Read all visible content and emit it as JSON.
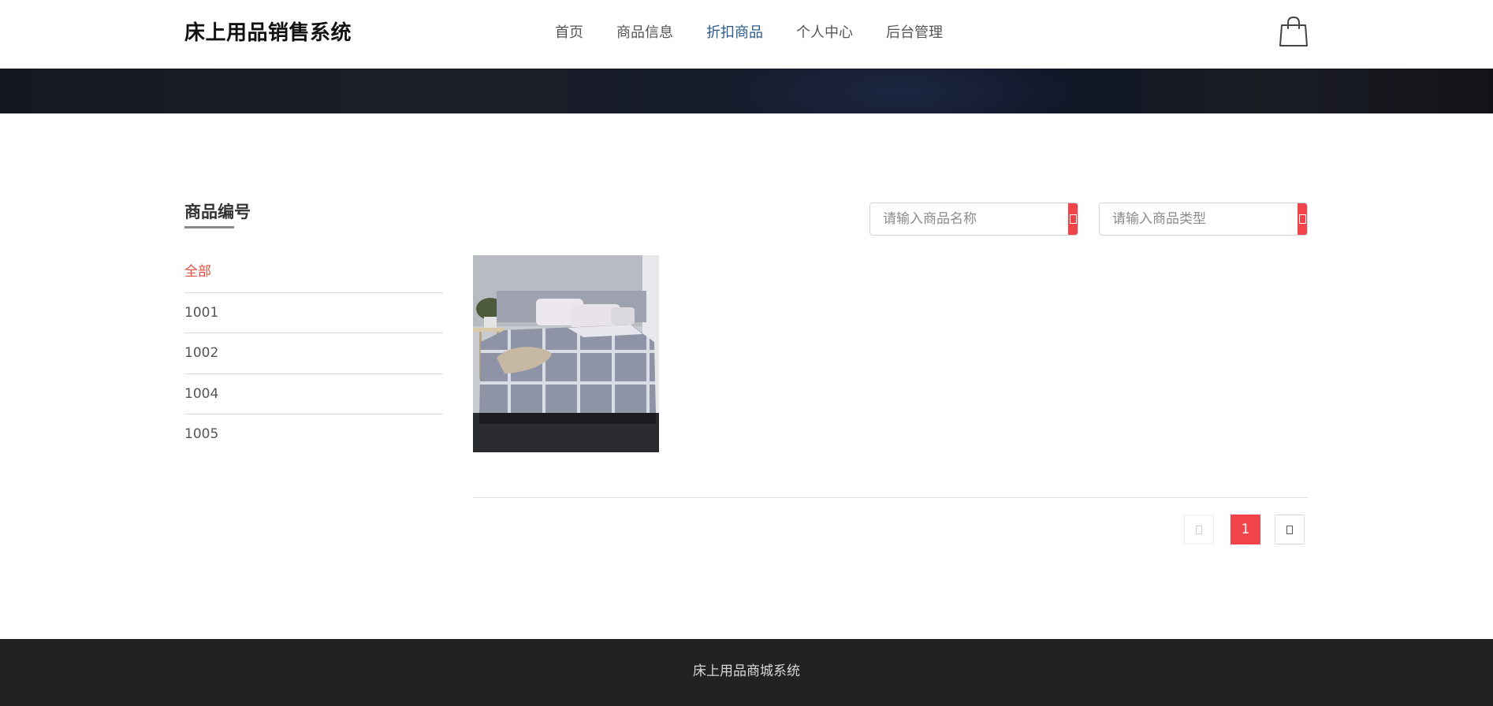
{
  "header": {
    "logo": "床上用品销售系统",
    "nav": [
      {
        "label": "首页",
        "active": false
      },
      {
        "label": "商品信息",
        "active": false
      },
      {
        "label": "折扣商品",
        "active": true
      },
      {
        "label": "个人中心",
        "active": false
      },
      {
        "label": "后台管理",
        "active": false
      }
    ],
    "cart_icon": "shopping-bag-icon"
  },
  "sidebar": {
    "title": "商品编号",
    "items": [
      {
        "label": "全部",
        "active": true
      },
      {
        "label": "1001",
        "active": false
      },
      {
        "label": "1002",
        "active": false
      },
      {
        "label": "1004",
        "active": false
      },
      {
        "label": "1005",
        "active": false
      }
    ]
  },
  "search": {
    "name_placeholder": "请输入商品名称",
    "name_value": "",
    "type_placeholder": "请输入商品类型",
    "type_value": ""
  },
  "products": [
    {
      "image": "bedding-grey-plaid-photo"
    }
  ],
  "pagination": {
    "current_page": "1"
  },
  "footer": {
    "text": "床上用品商城系统"
  },
  "colors": {
    "accent": "#f0444a",
    "active_nav": "#2a5a8c",
    "footer_bg": "#222222"
  }
}
